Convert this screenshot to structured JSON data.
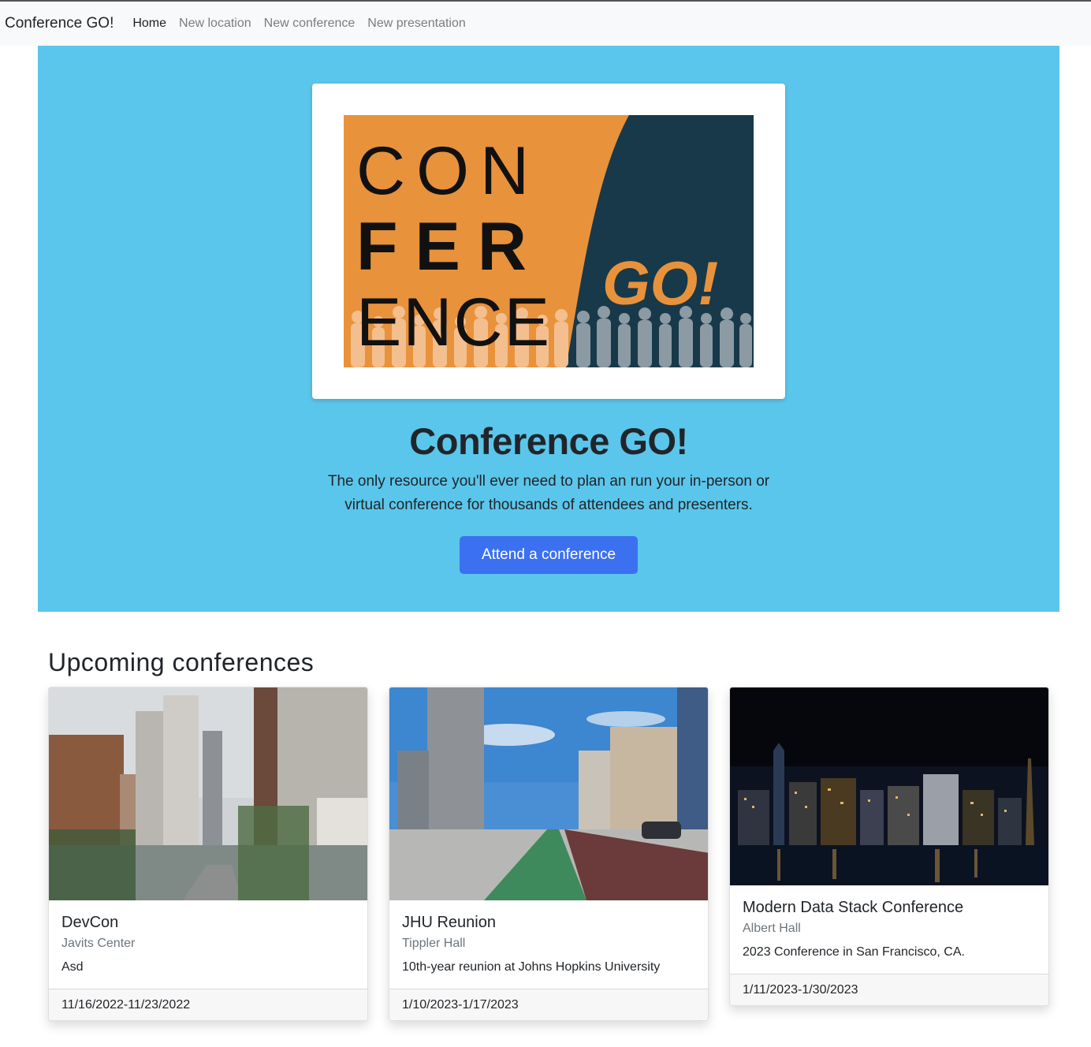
{
  "nav": {
    "brand": "Conference GO!",
    "links": [
      "Home",
      "New location",
      "New conference",
      "New presentation"
    ]
  },
  "hero": {
    "logo": {
      "line1": "CON",
      "line2": "FER",
      "line3": "ENCE",
      "go": "GO!"
    },
    "title": "Conference GO!",
    "lead": "The only resource you'll ever need to plan an run your in-person or virtual conference for thousands of attendees and presenters.",
    "button": "Attend a conference"
  },
  "section_title": "Upcoming conferences",
  "conferences": [
    {
      "name": "DevCon",
      "location": "Javits Center",
      "description": "Asd",
      "dates": "11/16/2022-11/23/2022"
    },
    {
      "name": "JHU Reunion",
      "location": "Tippler Hall",
      "description": "10th-year reunion at Johns Hopkins University",
      "dates": "1/10/2023-1/17/2023"
    },
    {
      "name": "Modern Data Stack Conference",
      "location": "Albert Hall",
      "description": "2023 Conference in San Francisco, CA.",
      "dates": "1/11/2023-1/30/2023"
    }
  ],
  "colors": {
    "hero_bg": "#5bc6eb",
    "button": "#3b71f0",
    "logo_orange": "#e8923c",
    "logo_navy": "#18394a"
  }
}
